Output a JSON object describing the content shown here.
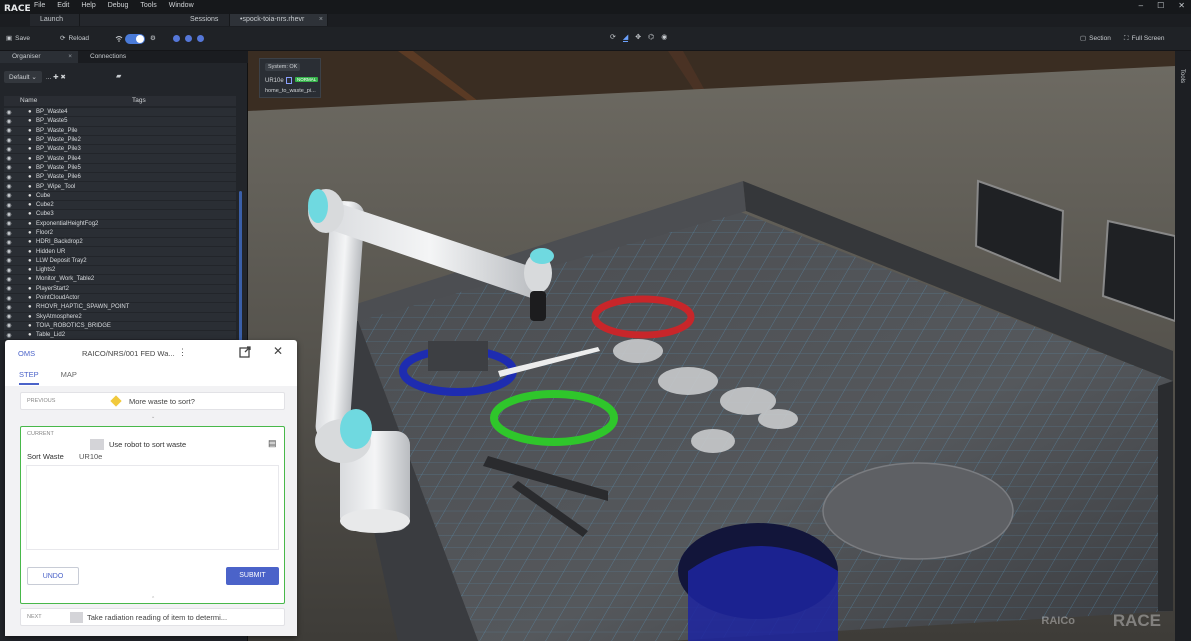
{
  "app": {
    "logo_text": "RACE",
    "menu": [
      "File",
      "Edit",
      "Help",
      "Debug",
      "Tools",
      "Window"
    ],
    "window_controls": [
      "–",
      "☐",
      "✕"
    ]
  },
  "tabs": [
    {
      "label": "Launch"
    },
    {
      "label": "Sessions"
    },
    {
      "label": "•spock-toia-nrs.rhevr",
      "close": "×"
    }
  ],
  "toolbar": {
    "save_label": "Save",
    "reload_label": "Reload",
    "section_label": "Section",
    "fullscreen_label": "Full Screen"
  },
  "left_panel": {
    "tabs": [
      {
        "label": "Organiser",
        "close": "×"
      },
      {
        "label": "Connections"
      }
    ],
    "filter_value": "Default",
    "filter_extras": "... ✚ ✖",
    "columns": {
      "name": "Name",
      "tags": "Tags"
    },
    "items": [
      "BP_Waste4",
      "BP_Waste5",
      "BP_Waste_Pile",
      "BP_Waste_Pile2",
      "BP_Waste_Pile3",
      "BP_Waste_Pile4",
      "BP_Waste_Pile5",
      "BP_Waste_Pile6",
      "BP_Wipe_Tool",
      "Cube",
      "Cube2",
      "Cube3",
      "ExponentialHeightFog2",
      "Floor2",
      "HDRI_Backdrop2",
      "Hidden UR",
      "LLW Deposit Tray2",
      "Lights2",
      "Monitor_Work_Table2",
      "PlayerStart2",
      "PointCloudActor",
      "RHOVR_HAPTIC_SPAWN_POINT",
      "SkyAtmosphere2",
      "TOIA_ROBOTICS_BRIDGE",
      "Table_Lid2"
    ]
  },
  "system_box": {
    "system_label": "System: OK",
    "robot": "UR10e",
    "status_badge": "NORMAL",
    "task": "home_to_waste_pi..."
  },
  "right_strip": {
    "tools_label": "Tools"
  },
  "oms": {
    "label": "OMS",
    "title": "RAICO/NRS/001 FED Wa...",
    "tabs": [
      "STEP",
      "MAP"
    ],
    "previous": {
      "label": "PREVIOUS",
      "text": "More waste to sort?"
    },
    "current": {
      "label": "CURRENT",
      "text": "Use robot to sort waste",
      "field_label": "Sort Waste",
      "field_value": "UR10e"
    },
    "undo_label": "UNDO",
    "submit_label": "SUBMIT",
    "next": {
      "label": "NEXT",
      "text": "Take radiation reading of item to determi..."
    }
  },
  "watermark": {
    "brand1": "RAICo",
    "brand2": "RACE"
  },
  "colors": {
    "accent": "#4b63c9",
    "toggle": "#4a7bd8",
    "ring_red": "#c8262a",
    "ring_blue": "#1e2cb0",
    "ring_green": "#2fc62b",
    "grid": "#5fb4e8"
  }
}
